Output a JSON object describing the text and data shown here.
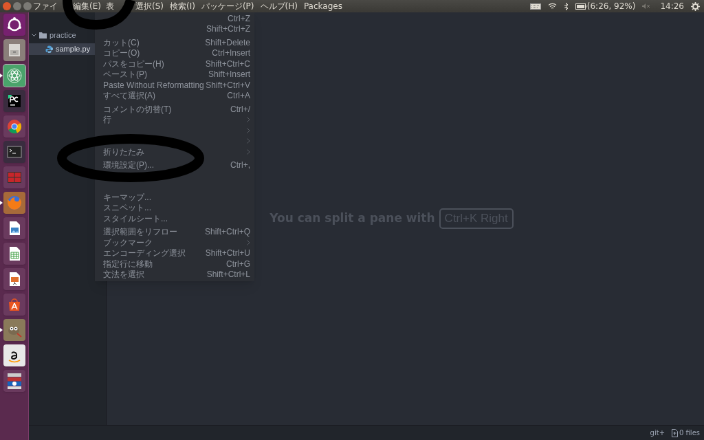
{
  "top_panel": {
    "menus": [
      {
        "label": "ファイ"
      },
      {
        "label": "編集(E)"
      },
      {
        "label": "表"
      },
      {
        "label": "選択(S)"
      },
      {
        "label": "検索(I)"
      },
      {
        "label": "パッケージ(P)"
      },
      {
        "label": "ヘルプ(H)"
      },
      {
        "label": "Packages"
      }
    ],
    "battery": "(6:26, 92%)",
    "clock": "14:26"
  },
  "launcher": [
    {
      "kind": "ubuntu",
      "running": false,
      "focused": false
    },
    {
      "kind": "files",
      "running": false,
      "focused": false
    },
    {
      "kind": "atom",
      "running": true,
      "focused": true
    },
    {
      "kind": "pc",
      "running": false,
      "focused": false
    },
    {
      "kind": "browser",
      "running": false,
      "focused": false
    },
    {
      "kind": "terminal",
      "running": false,
      "focused": false
    },
    {
      "kind": "workspaces",
      "running": false,
      "focused": false
    },
    {
      "kind": "firefox",
      "running": true,
      "focused": false
    },
    {
      "kind": "draw",
      "running": false,
      "focused": false
    },
    {
      "kind": "calc",
      "running": false,
      "focused": false
    },
    {
      "kind": "impress",
      "running": false,
      "focused": false
    },
    {
      "kind": "store",
      "running": false,
      "focused": false
    },
    {
      "kind": "gimp",
      "running": true,
      "focused": false
    },
    {
      "kind": "amazon",
      "running": false,
      "focused": false
    },
    {
      "kind": "stack",
      "running": false,
      "focused": false
    }
  ],
  "tree": {
    "folder": "practice",
    "expanded": true,
    "files": [
      {
        "name": "sample.py",
        "selected": true
      }
    ]
  },
  "edit_menu": {
    "groups": [
      [
        {
          "shortcut": "Ctrl+Z"
        },
        {
          "shortcut": "Shift+Ctrl+Z"
        }
      ],
      [
        {
          "label": "カット(C)",
          "shortcut": "Shift+Delete"
        },
        {
          "label": "コピー(O)",
          "shortcut": "Ctrl+Insert"
        },
        {
          "label": "パスをコピー(H)",
          "shortcut": "Shift+Ctrl+C"
        },
        {
          "label": "ペースト(P)",
          "shortcut": "Shift+Insert"
        },
        {
          "label": "Paste Without Reformatting",
          "shortcut": "Shift+Ctrl+V"
        },
        {
          "label": "すべて選択(A)",
          "shortcut": "Ctrl+A"
        }
      ],
      [
        {
          "label": "コメントの切替(T)",
          "shortcut": "Ctrl+/"
        },
        {
          "label": "行",
          "submenu": true
        },
        {
          "submenu": true
        },
        {
          "submenu": true
        },
        {
          "label": "折りたたみ",
          "submenu": true
        }
      ],
      [
        {
          "label": "環境設定(P)...",
          "shortcut": "Ctrl+,"
        },
        {
          "kind": "hidden"
        },
        {
          "kind": "hidden"
        },
        {
          "label": "キーマップ..."
        },
        {
          "label": "スニペット..."
        },
        {
          "label": "スタイルシート..."
        }
      ],
      [
        {
          "label": "選択範囲をリフロー",
          "shortcut": "Shift+Ctrl+Q"
        },
        {
          "label": "ブックマーク",
          "submenu": true
        },
        {
          "label": "エンコーディング選択",
          "shortcut": "Shift+Ctrl+U"
        },
        {
          "label": "指定行に移動",
          "shortcut": "Ctrl+G"
        },
        {
          "label": "文法を選択",
          "shortcut": "Shift+Ctrl+L"
        }
      ]
    ]
  },
  "editor": {
    "hint": "You can split a pane with",
    "hint_key": "Ctrl+K Right"
  },
  "status_bar": {
    "git": "git+",
    "files": "0 files"
  }
}
